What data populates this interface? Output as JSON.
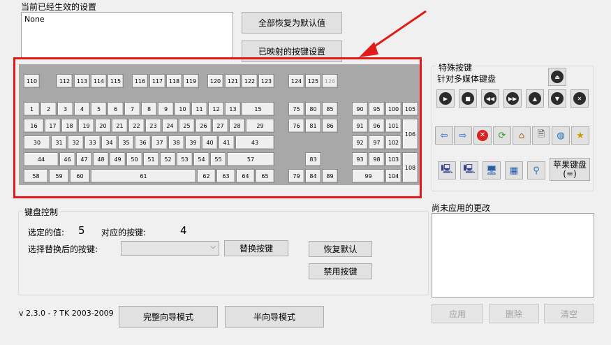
{
  "current_settings": {
    "label": "当前已经生效的设置",
    "value": "None"
  },
  "buttons": {
    "restore_all": "全部恢复为默认值",
    "mapped_keys": "已映射的按键设置"
  },
  "special_keys": {
    "label": "特殊按键",
    "multimedia_label": "针对多媒体键盘",
    "apple_keyboard": "苹果键盘\n(=)"
  },
  "keyboard_control": {
    "group_label": "键盘控制",
    "selected_value_label": "选定的值:",
    "selected_value": "5",
    "mapped_key_label": "对应的按键:",
    "mapped_key": "4",
    "replace_label": "选择替换后的按键:",
    "replace_button": "替换按键",
    "restore_default_button": "恢复默认",
    "disable_key_button": "禁用按键"
  },
  "pending": {
    "label": "尚未应用的更改",
    "apply": "应用",
    "delete": "删除",
    "clear": "清空"
  },
  "version": "v 2.3.0 - ? TK 2003-2009",
  "mode_buttons": {
    "full_wizard": "完整向导模式",
    "half_wizard": "半向导模式"
  },
  "keys": {
    "k110": "110",
    "k112": "112",
    "k113": "113",
    "k114": "114",
    "k115": "115",
    "k116": "116",
    "k117": "117",
    "k118": "118",
    "k119": "119",
    "k120": "120",
    "k121": "121",
    "k122": "122",
    "k123": "123",
    "k124": "124",
    "k125": "125",
    "k126": "126",
    "k1": "1",
    "k2": "2",
    "k3": "3",
    "k4": "4",
    "k5": "5",
    "k6": "6",
    "k7": "7",
    "k8": "8",
    "k9": "9",
    "k10": "10",
    "k11": "11",
    "k12": "12",
    "k13": "13",
    "k15": "15",
    "k75": "75",
    "k80": "80",
    "k85": "85",
    "k90": "90",
    "k95": "95",
    "k100": "100",
    "k105": "105",
    "k16": "16",
    "k17": "17",
    "k18": "18",
    "k19": "19",
    "k20": "20",
    "k21": "21",
    "k22": "22",
    "k23": "23",
    "k24": "24",
    "k25": "25",
    "k26": "26",
    "k27": "27",
    "k28": "28",
    "k29": "29",
    "k76": "76",
    "k81": "81",
    "k86": "86",
    "k91": "91",
    "k96": "96",
    "k101": "101",
    "k106": "106",
    "k30": "30",
    "k31": "31",
    "k32": "32",
    "k33": "33",
    "k34": "34",
    "k35": "35",
    "k36": "36",
    "k37": "37",
    "k38": "38",
    "k39": "39",
    "k40": "40",
    "k41": "41",
    "k43": "43",
    "k92": "92",
    "k97": "97",
    "k102": "102",
    "k44": "44",
    "k46": "46",
    "k47": "47",
    "k48": "48",
    "k49": "49",
    "k50": "50",
    "k51": "51",
    "k52": "52",
    "k53": "53",
    "k54": "54",
    "k55": "55",
    "k57": "57",
    "k83": "83",
    "k93": "93",
    "k98": "98",
    "k103": "103",
    "k108": "108",
    "k58": "58",
    "k59": "59",
    "k60": "60",
    "k61": "61",
    "k62": "62",
    "k63": "63",
    "k64": "64",
    "k65": "65",
    "k79": "79",
    "k84": "84",
    "k89": "89",
    "k99": "99",
    "k104": "104"
  },
  "highlight_color": "#e21a1a",
  "icons": {
    "eject": "eject-icon",
    "play": "play-icon",
    "stop": "stop-icon",
    "prev": "prev-track-icon",
    "next": "next-track-icon",
    "vol_up": "volume-up-icon",
    "vol_down": "volume-down-icon",
    "mute": "mute-icon",
    "back": "back-arrow-icon",
    "forward": "forward-arrow-icon",
    "stop_web": "stop-web-icon",
    "refresh": "refresh-icon",
    "home": "home-icon",
    "search_doc": "search-doc-icon",
    "web": "web-globe-icon",
    "favorites": "favorites-icon",
    "mycomputer1": "my-computer-icon",
    "mycomputer2": "computer-2-icon",
    "computer3": "computer-3-icon",
    "calculator": "calculator-icon",
    "search": "search-icon"
  }
}
